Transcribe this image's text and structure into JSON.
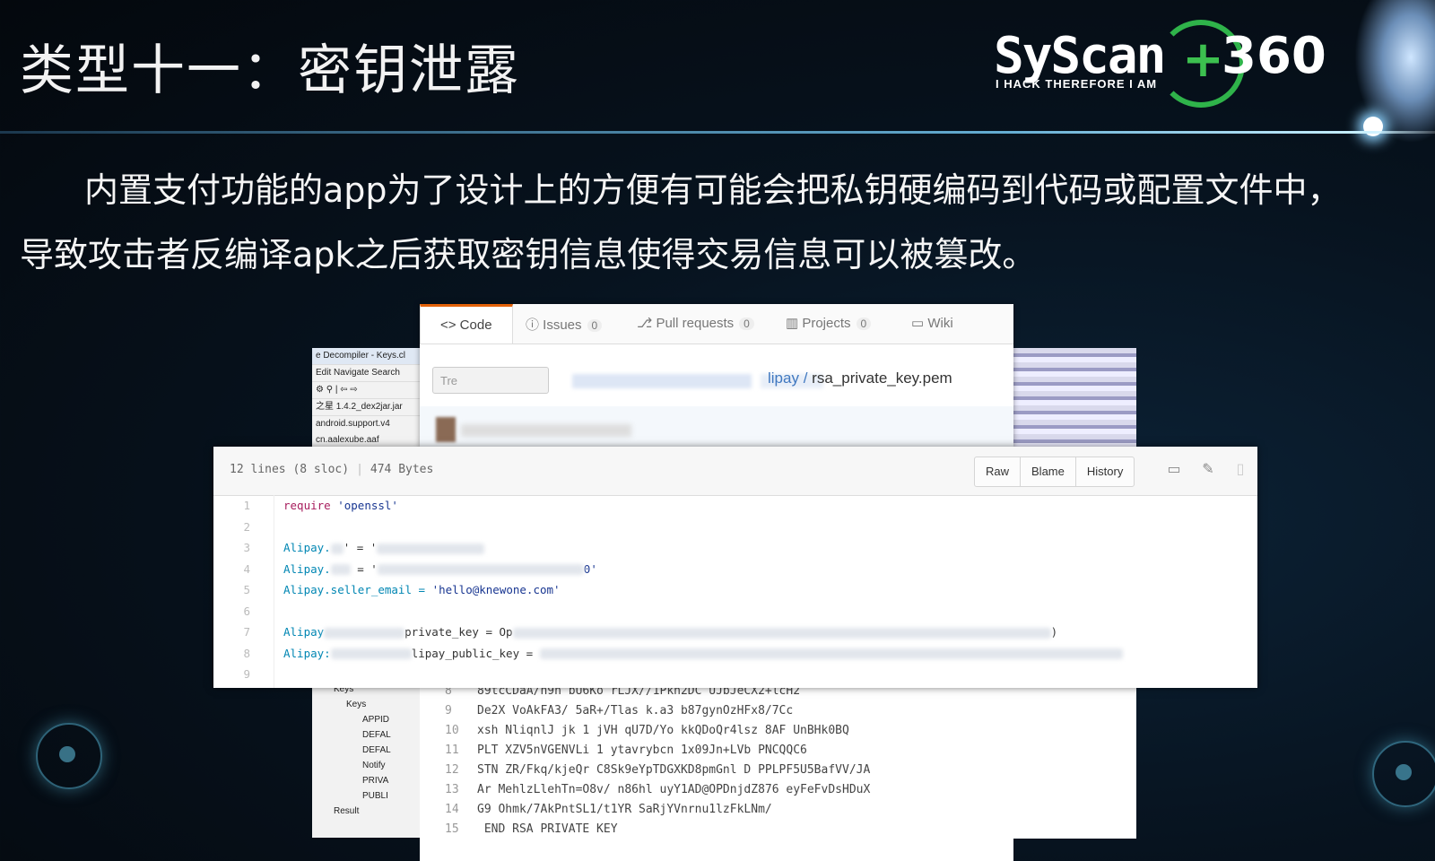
{
  "slide": {
    "title": "类型十一：密钥泄露",
    "paragraph_line1": "内置支付功能的app为了设计上的方便有可能会把私钥硬编码到代码或配置文件中，",
    "paragraph_line2": "导致攻击者反编译apk之后获取密钥信息使得交易信息可以被篡改。"
  },
  "logo": {
    "wordmark": "SyScan",
    "plus": "+",
    "number": "360",
    "tagline": "I HACK THEREFORE I AM"
  },
  "github": {
    "tabs": [
      {
        "label": "<> Code",
        "count": ""
      },
      {
        "label": "Issues",
        "count": "0"
      },
      {
        "label": "Pull requests",
        "count": "0"
      },
      {
        "label": "Projects",
        "count": "0"
      },
      {
        "label": "Wiki",
        "count": ""
      }
    ],
    "branch_label": "Tre",
    "breadcrumb_dir": "lipay",
    "breadcrumb_sep": "/",
    "breadcrumb_file": "rsa_private_key.pem",
    "file_lines": "12 lines (8 sloc)",
    "file_size": "474 Bytes",
    "buttons": {
      "raw": "Raw",
      "blame": "Blame",
      "history": "History"
    },
    "code_lines": [
      {
        "n": "1",
        "a": "require",
        "b": "'openssl'"
      },
      {
        "n": "2"
      },
      {
        "n": "3",
        "a": "Alipay.",
        "b": "' = '"
      },
      {
        "n": "4",
        "a": "Alipay.",
        "b": "0'"
      },
      {
        "n": "5",
        "a": "Alipay.seller_email = ",
        "b": "'hello@knewone.com'"
      },
      {
        "n": "6"
      },
      {
        "n": "7",
        "a": "Alipay",
        "b": "private_key = Op",
        "c": ")"
      },
      {
        "n": "8",
        "a": "Alipay:",
        "b": "lipay_public_key = "
      },
      {
        "n": "9"
      }
    ]
  },
  "decompiler": {
    "title": "e Decompiler - Keys.cl",
    "menu": "Edit  Navigate  Search",
    "jar": "之星 1.4.2_dex2jar.jar",
    "tree_top": [
      "android.support.v4",
      "cn.aalexube.aaf"
    ],
    "tree_bottom": [
      "Keys",
      "Keys",
      "APPID",
      "DEFAL",
      "DEFAL",
      "Notify",
      "PRIVA",
      "PUBLI",
      "Result"
    ]
  },
  "pem_lines": [
    {
      "n": "8",
      "t": "89tcCDaA/n9n     bU6Ko     rLJX//1Pkn2DC         UJbJeCX2+lcH2"
    },
    {
      "n": "9",
      "t": "De2X  VoAkFA3/      5aR+/Tlas    k.a3          b87gynOzHFx8/7Cc"
    },
    {
      "n": "10",
      "t": "xsh  NliqnlJ  jk    1 jVH qU7D/Yo          kkQDoQr4lsz    8AF UnBHk0BQ"
    },
    {
      "n": "11",
      "t": "PLT   XZV5nVGENVLi        1 ytavrybcn      1x09Jn+LVb       PNCQQC6"
    },
    {
      "n": "12",
      "t": "STN  ZR/Fkq/kjeQr      C8Sk9eYpTDGXKD8pmGnl       D PPLPF5U5BafVV/JA"
    },
    {
      "n": "13",
      "t": "Ar   MehlzLlehTn=O8v/       n86hl uyY1AD@OPDnjdZ876         eyFeFvDsHDuX"
    },
    {
      "n": "14",
      "t": "G9    Ohmk/7AkPntSL1/t1YR   SaRjYVnrnu1lzFkLNm/"
    },
    {
      "n": "15",
      "t": "     END RSA PRIVATE KEY"
    }
  ],
  "colors": {
    "accent_green": "#3cc04f",
    "github_orange": "#e36209",
    "link_blue": "#4078c0"
  }
}
